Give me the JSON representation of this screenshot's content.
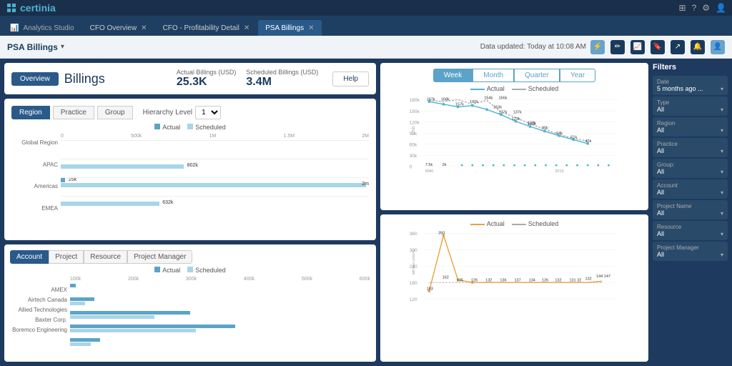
{
  "app": {
    "logo": "certinia",
    "top_icons": [
      "grid-icon",
      "question-icon",
      "gear-icon",
      "user-icon"
    ]
  },
  "tabs": [
    {
      "label": "Analytics Studio",
      "active": false,
      "closeable": false
    },
    {
      "label": "CFO Overview",
      "active": false,
      "closeable": true
    },
    {
      "label": "CFO - Profitability Detail",
      "active": false,
      "closeable": true
    },
    {
      "label": "PSA Billings",
      "active": true,
      "closeable": true
    }
  ],
  "toolbar": {
    "title": "PSA Billings",
    "dropdown": true,
    "data_updated": "Data updated: Today at 10:08 AM",
    "icons": [
      "lightning-icon",
      "edit-icon",
      "chart-icon",
      "bookmark-icon",
      "share-icon",
      "bell-icon",
      "user-icon"
    ]
  },
  "billings": {
    "overview_btn": "Overview",
    "title": "Billings",
    "actual_label": "Actual Billings (USD)",
    "actual_value": "25.3K",
    "scheduled_label": "Scheduled Billings (USD)",
    "scheduled_value": "3.4M",
    "help_btn": "Help"
  },
  "region_chart": {
    "tabs": [
      "Region",
      "Practice",
      "Group"
    ],
    "active_tab": "Region",
    "hierarchy_label": "Hierarchy Level",
    "hierarchy_value": "1",
    "legend": [
      "Actual",
      "Scheduled"
    ],
    "x_axis": [
      "0",
      "500k",
      "1M",
      "1.5M",
      "2M"
    ],
    "rows": [
      {
        "label": "Global Region",
        "actual_pct": 0,
        "scheduled_pct": 0,
        "actual_val": "",
        "scheduled_val": ""
      },
      {
        "label": "APAC",
        "actual_pct": 0,
        "scheduled_pct": 40,
        "actual_val": "",
        "scheduled_val": "802k"
      },
      {
        "label": "Americas",
        "actual_pct": 1.5,
        "scheduled_pct": 100,
        "actual_val": "25k",
        "scheduled_val": "2m"
      },
      {
        "label": "EMEA",
        "actual_pct": 0,
        "scheduled_pct": 32,
        "actual_val": "",
        "scheduled_val": "632k"
      }
    ]
  },
  "account_chart": {
    "tabs": [
      "Account",
      "Project",
      "Resource",
      "Project Manager"
    ],
    "active_tab": "Account",
    "legend": [
      "Actual",
      "Scheduled"
    ],
    "x_axis": [
      "100k",
      "200k",
      "300k",
      "400k",
      "500k",
      "600k"
    ],
    "rows": [
      {
        "label": "AMEX",
        "actual_pct": 2,
        "scheduled_pct": 0
      },
      {
        "label": "Airtech Canada",
        "actual_pct": 8,
        "scheduled_pct": 5
      },
      {
        "label": "Allied Technologies",
        "actual_pct": 40,
        "scheduled_pct": 28
      },
      {
        "label": "Baxter Corp.",
        "actual_pct": 55,
        "scheduled_pct": 42
      },
      {
        "label": "Boremco Engineering",
        "actual_pct": 10,
        "scheduled_pct": 7
      }
    ]
  },
  "time_chart": {
    "tabs": [
      "Week",
      "Month",
      "Quarter",
      "Year"
    ],
    "active_tab": "Week",
    "legend": [
      "Actual",
      "Scheduled"
    ],
    "y_labels": [
      "180k",
      "150k",
      "120k",
      "90k",
      "60k",
      "30k",
      "0"
    ],
    "data_points": [
      {
        "x": "W40",
        "actual": 167,
        "scheduled": 168
      },
      {
        "x": "",
        "actual": 161,
        "scheduled": 157
      },
      {
        "x": "",
        "actual": 152,
        "scheduled": 160
      },
      {
        "x": "",
        "actual": 160,
        "scheduled": 154
      },
      {
        "x": "",
        "actual": 153,
        "scheduled": 166
      },
      {
        "x": "",
        "actual": 137,
        "scheduled": 137
      },
      {
        "x": "",
        "actual": 122,
        "scheduled": 132
      },
      {
        "x": "",
        "actual": 102,
        "scheduled": 112
      },
      {
        "x": "",
        "actual": 90,
        "scheduled": 98
      },
      {
        "x": "2019",
        "actual": 64,
        "scheduled": 75
      },
      {
        "x": "",
        "actual": 51,
        "scheduled": 60
      },
      {
        "x": "",
        "actual": 42,
        "scheduled": 50
      }
    ],
    "annotations": [
      "167k",
      "168k",
      "157k",
      "160k",
      "154k",
      "166k",
      "153k",
      "137k",
      "137k",
      "132k",
      "122k",
      "102k",
      "90k",
      "64k",
      "51k",
      "42k",
      "7.5k",
      "2k"
    ]
  },
  "billing_rate_chart": {
    "legend": [
      "Actual",
      "Scheduled"
    ],
    "y_label": "Bill Rate (USD/h)",
    "y_max": 360,
    "peak_value": 350,
    "annotations": [
      "350",
      "183",
      "162",
      "135",
      "126",
      "132",
      "136",
      "137",
      "134",
      "126",
      "132",
      "131",
      "32",
      "132",
      "144",
      "147"
    ]
  },
  "filters": {
    "title": "Filters",
    "items": [
      {
        "label": "Date",
        "value": "5 months ago ..."
      },
      {
        "label": "Type",
        "value": "All"
      },
      {
        "label": "Region",
        "value": "All"
      },
      {
        "label": "Practice",
        "value": "All"
      },
      {
        "label": "Group",
        "value": "All"
      },
      {
        "label": "Account",
        "value": "All"
      },
      {
        "label": "Project Name",
        "value": "All"
      },
      {
        "label": "Resource",
        "value": "All"
      },
      {
        "label": "Project Manager",
        "value": "All"
      }
    ]
  }
}
